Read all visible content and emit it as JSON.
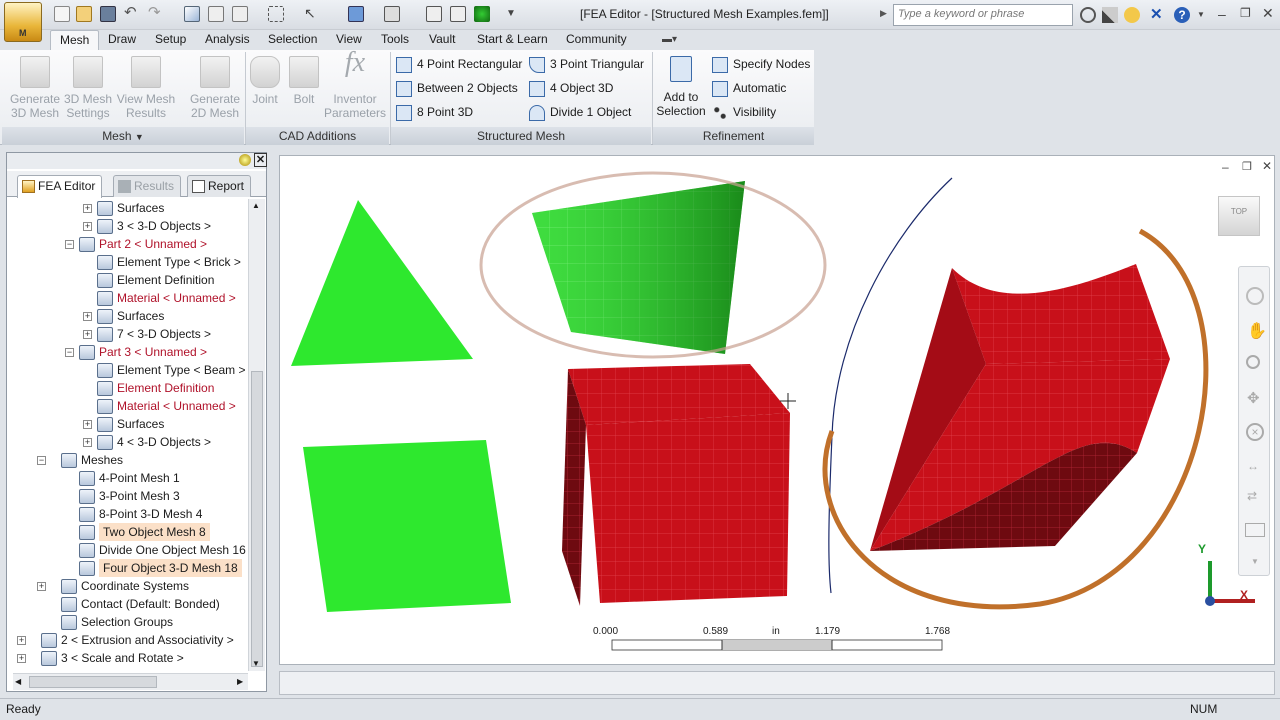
{
  "window": {
    "title": "[FEA Editor - [Structured Mesh Examples.fem]]",
    "search_placeholder": "Type a keyword or phrase",
    "app_button_letter": "M"
  },
  "ribbon_tabs": [
    "Mesh",
    "Draw",
    "Setup",
    "Analysis",
    "Selection",
    "View",
    "Tools",
    "Vault",
    "Start & Learn",
    "Community"
  ],
  "active_tab": "Mesh",
  "ribbon": {
    "mesh_panel": {
      "title": "Mesh",
      "buttons": [
        "Generate\n3D Mesh",
        "3D Mesh\nSettings",
        "View Mesh\nResults",
        "Generate\n2D Mesh"
      ]
    },
    "cad_panel": {
      "title": "CAD Additions",
      "buttons": [
        "Joint",
        "Bolt",
        "Inventor\nParameters"
      ]
    },
    "structured_panel": {
      "title": "Structured Mesh",
      "items": [
        "4 Point Rectangular",
        "3 Point Triangular",
        "Between 2 Objects",
        "4 Object 3D",
        "8 Point 3D",
        "Divide 1 Object"
      ]
    },
    "refinement_panel": {
      "title": "Refinement",
      "add_button": "Add to\nSelection",
      "items": [
        "Specify Nodes",
        "Automatic",
        "Visibility"
      ]
    }
  },
  "left_panel": {
    "tabs": [
      "FEA Editor",
      "Results",
      "Report"
    ],
    "active_tab": "FEA Editor",
    "tree": [
      {
        "label": "Surfaces",
        "level": 3,
        "expander": "+",
        "red": false
      },
      {
        "label": "3 < 3-D Objects >",
        "level": 3,
        "expander": "+",
        "red": false
      },
      {
        "label": "Part 2 < Unnamed >",
        "level": 2,
        "expander": "-",
        "red": true
      },
      {
        "label": "Element Type < Brick >",
        "level": 3,
        "expander": "",
        "red": false
      },
      {
        "label": "Element Definition",
        "level": 3,
        "expander": "",
        "red": false
      },
      {
        "label": "Material < Unnamed >",
        "level": 3,
        "expander": "",
        "red": true
      },
      {
        "label": "Surfaces",
        "level": 3,
        "expander": "+",
        "red": false
      },
      {
        "label": "7 < 3-D Objects >",
        "level": 3,
        "expander": "+",
        "red": false
      },
      {
        "label": "Part 3 < Unnamed >",
        "level": 2,
        "expander": "-",
        "red": true
      },
      {
        "label": "Element Type < Beam >",
        "level": 3,
        "expander": "",
        "red": false
      },
      {
        "label": "Element Definition",
        "level": 3,
        "expander": "",
        "red": true
      },
      {
        "label": "Material < Unnamed >",
        "level": 3,
        "expander": "",
        "red": true
      },
      {
        "label": "Surfaces",
        "level": 3,
        "expander": "+",
        "red": false
      },
      {
        "label": "4 < 3-D Objects >",
        "level": 3,
        "expander": "+",
        "red": false
      },
      {
        "label": "Meshes",
        "level": 1,
        "expander": "-",
        "red": false
      },
      {
        "label": "4-Point Mesh 1",
        "level": 2,
        "expander": "",
        "red": false
      },
      {
        "label": "3-Point Mesh 3",
        "level": 2,
        "expander": "",
        "red": false
      },
      {
        "label": "8-Point 3-D Mesh 4",
        "level": 2,
        "expander": "",
        "red": false
      },
      {
        "label": "Two Object Mesh 8",
        "level": 2,
        "expander": "",
        "red": false,
        "highlight": true
      },
      {
        "label": "Divide One Object Mesh 16",
        "level": 2,
        "expander": "",
        "red": false
      },
      {
        "label": "Four Object 3-D Mesh 18",
        "level": 2,
        "expander": "",
        "red": false,
        "highlight": true
      },
      {
        "label": "Coordinate Systems",
        "level": 1,
        "expander": "+",
        "red": false
      },
      {
        "label": "Contact (Default: Bonded)",
        "level": 1,
        "expander": "",
        "red": false
      },
      {
        "label": "Selection Groups",
        "level": 1,
        "expander": "",
        "red": false
      },
      {
        "label": "2 < Extrusion and Associativity >",
        "level": 0,
        "expander": "+",
        "red": false
      },
      {
        "label": "3 < Scale and Rotate >",
        "level": 0,
        "expander": "+",
        "red": false
      }
    ]
  },
  "viewport": {
    "viewcube_label": "TOP",
    "scale_labels": [
      "0.000",
      "0.589",
      "in",
      "1.179",
      "1.768"
    ],
    "axis_labels": [
      "Y",
      "X"
    ]
  },
  "status": {
    "left": "Ready",
    "right": "NUM"
  },
  "colors": {
    "mesh_green": "#33ee33",
    "mesh_red": "#c8101a",
    "highlight_orange": "#c0702a"
  }
}
